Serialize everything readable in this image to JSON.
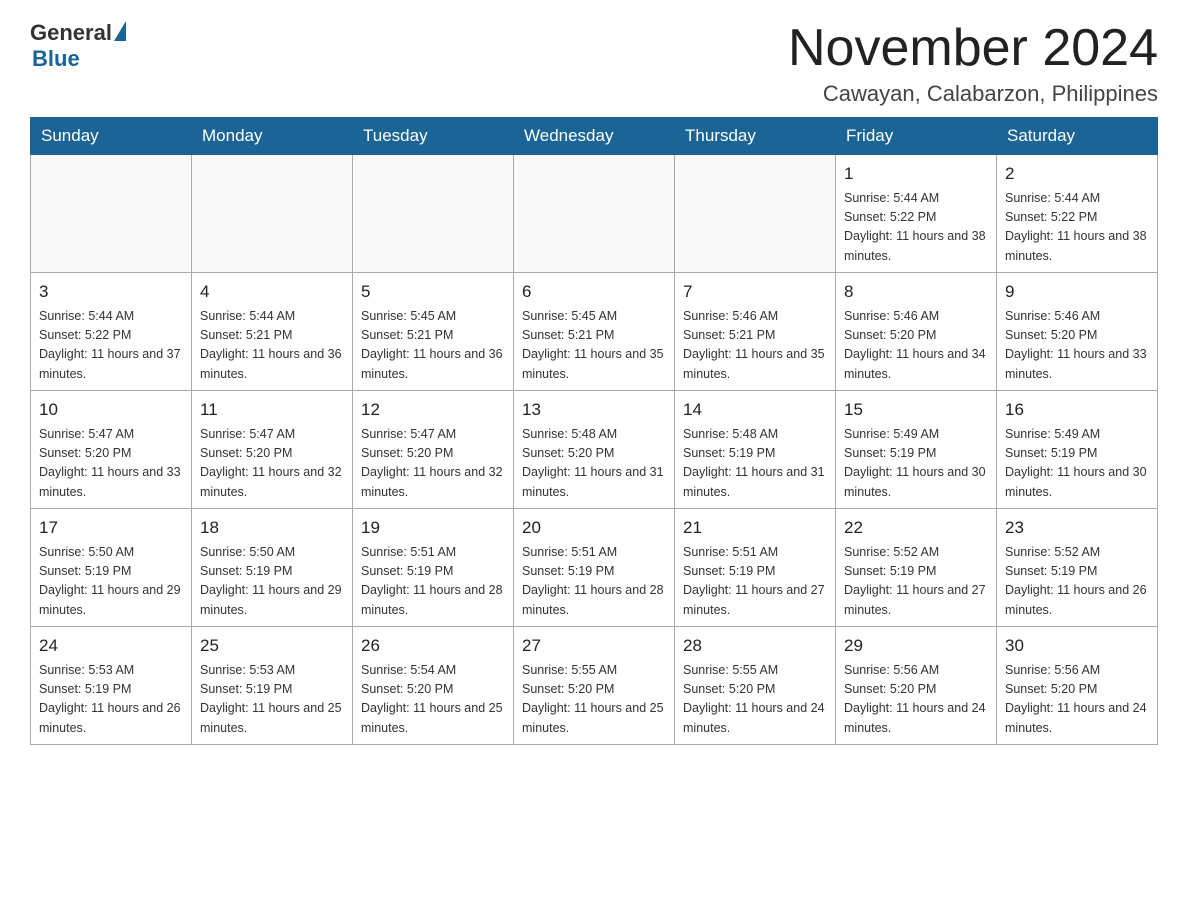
{
  "logo": {
    "general": "General",
    "blue": "Blue"
  },
  "header": {
    "month": "November 2024",
    "location": "Cawayan, Calabarzon, Philippines"
  },
  "weekdays": [
    "Sunday",
    "Monday",
    "Tuesday",
    "Wednesday",
    "Thursday",
    "Friday",
    "Saturday"
  ],
  "weeks": [
    [
      {
        "day": "",
        "sunrise": "",
        "sunset": "",
        "daylight": ""
      },
      {
        "day": "",
        "sunrise": "",
        "sunset": "",
        "daylight": ""
      },
      {
        "day": "",
        "sunrise": "",
        "sunset": "",
        "daylight": ""
      },
      {
        "day": "",
        "sunrise": "",
        "sunset": "",
        "daylight": ""
      },
      {
        "day": "",
        "sunrise": "",
        "sunset": "",
        "daylight": ""
      },
      {
        "day": "1",
        "sunrise": "Sunrise: 5:44 AM",
        "sunset": "Sunset: 5:22 PM",
        "daylight": "Daylight: 11 hours and 38 minutes."
      },
      {
        "day": "2",
        "sunrise": "Sunrise: 5:44 AM",
        "sunset": "Sunset: 5:22 PM",
        "daylight": "Daylight: 11 hours and 38 minutes."
      }
    ],
    [
      {
        "day": "3",
        "sunrise": "Sunrise: 5:44 AM",
        "sunset": "Sunset: 5:22 PM",
        "daylight": "Daylight: 11 hours and 37 minutes."
      },
      {
        "day": "4",
        "sunrise": "Sunrise: 5:44 AM",
        "sunset": "Sunset: 5:21 PM",
        "daylight": "Daylight: 11 hours and 36 minutes."
      },
      {
        "day": "5",
        "sunrise": "Sunrise: 5:45 AM",
        "sunset": "Sunset: 5:21 PM",
        "daylight": "Daylight: 11 hours and 36 minutes."
      },
      {
        "day": "6",
        "sunrise": "Sunrise: 5:45 AM",
        "sunset": "Sunset: 5:21 PM",
        "daylight": "Daylight: 11 hours and 35 minutes."
      },
      {
        "day": "7",
        "sunrise": "Sunrise: 5:46 AM",
        "sunset": "Sunset: 5:21 PM",
        "daylight": "Daylight: 11 hours and 35 minutes."
      },
      {
        "day": "8",
        "sunrise": "Sunrise: 5:46 AM",
        "sunset": "Sunset: 5:20 PM",
        "daylight": "Daylight: 11 hours and 34 minutes."
      },
      {
        "day": "9",
        "sunrise": "Sunrise: 5:46 AM",
        "sunset": "Sunset: 5:20 PM",
        "daylight": "Daylight: 11 hours and 33 minutes."
      }
    ],
    [
      {
        "day": "10",
        "sunrise": "Sunrise: 5:47 AM",
        "sunset": "Sunset: 5:20 PM",
        "daylight": "Daylight: 11 hours and 33 minutes."
      },
      {
        "day": "11",
        "sunrise": "Sunrise: 5:47 AM",
        "sunset": "Sunset: 5:20 PM",
        "daylight": "Daylight: 11 hours and 32 minutes."
      },
      {
        "day": "12",
        "sunrise": "Sunrise: 5:47 AM",
        "sunset": "Sunset: 5:20 PM",
        "daylight": "Daylight: 11 hours and 32 minutes."
      },
      {
        "day": "13",
        "sunrise": "Sunrise: 5:48 AM",
        "sunset": "Sunset: 5:20 PM",
        "daylight": "Daylight: 11 hours and 31 minutes."
      },
      {
        "day": "14",
        "sunrise": "Sunrise: 5:48 AM",
        "sunset": "Sunset: 5:19 PM",
        "daylight": "Daylight: 11 hours and 31 minutes."
      },
      {
        "day": "15",
        "sunrise": "Sunrise: 5:49 AM",
        "sunset": "Sunset: 5:19 PM",
        "daylight": "Daylight: 11 hours and 30 minutes."
      },
      {
        "day": "16",
        "sunrise": "Sunrise: 5:49 AM",
        "sunset": "Sunset: 5:19 PM",
        "daylight": "Daylight: 11 hours and 30 minutes."
      }
    ],
    [
      {
        "day": "17",
        "sunrise": "Sunrise: 5:50 AM",
        "sunset": "Sunset: 5:19 PM",
        "daylight": "Daylight: 11 hours and 29 minutes."
      },
      {
        "day": "18",
        "sunrise": "Sunrise: 5:50 AM",
        "sunset": "Sunset: 5:19 PM",
        "daylight": "Daylight: 11 hours and 29 minutes."
      },
      {
        "day": "19",
        "sunrise": "Sunrise: 5:51 AM",
        "sunset": "Sunset: 5:19 PM",
        "daylight": "Daylight: 11 hours and 28 minutes."
      },
      {
        "day": "20",
        "sunrise": "Sunrise: 5:51 AM",
        "sunset": "Sunset: 5:19 PM",
        "daylight": "Daylight: 11 hours and 28 minutes."
      },
      {
        "day": "21",
        "sunrise": "Sunrise: 5:51 AM",
        "sunset": "Sunset: 5:19 PM",
        "daylight": "Daylight: 11 hours and 27 minutes."
      },
      {
        "day": "22",
        "sunrise": "Sunrise: 5:52 AM",
        "sunset": "Sunset: 5:19 PM",
        "daylight": "Daylight: 11 hours and 27 minutes."
      },
      {
        "day": "23",
        "sunrise": "Sunrise: 5:52 AM",
        "sunset": "Sunset: 5:19 PM",
        "daylight": "Daylight: 11 hours and 26 minutes."
      }
    ],
    [
      {
        "day": "24",
        "sunrise": "Sunrise: 5:53 AM",
        "sunset": "Sunset: 5:19 PM",
        "daylight": "Daylight: 11 hours and 26 minutes."
      },
      {
        "day": "25",
        "sunrise": "Sunrise: 5:53 AM",
        "sunset": "Sunset: 5:19 PM",
        "daylight": "Daylight: 11 hours and 25 minutes."
      },
      {
        "day": "26",
        "sunrise": "Sunrise: 5:54 AM",
        "sunset": "Sunset: 5:20 PM",
        "daylight": "Daylight: 11 hours and 25 minutes."
      },
      {
        "day": "27",
        "sunrise": "Sunrise: 5:55 AM",
        "sunset": "Sunset: 5:20 PM",
        "daylight": "Daylight: 11 hours and 25 minutes."
      },
      {
        "day": "28",
        "sunrise": "Sunrise: 5:55 AM",
        "sunset": "Sunset: 5:20 PM",
        "daylight": "Daylight: 11 hours and 24 minutes."
      },
      {
        "day": "29",
        "sunrise": "Sunrise: 5:56 AM",
        "sunset": "Sunset: 5:20 PM",
        "daylight": "Daylight: 11 hours and 24 minutes."
      },
      {
        "day": "30",
        "sunrise": "Sunrise: 5:56 AM",
        "sunset": "Sunset: 5:20 PM",
        "daylight": "Daylight: 11 hours and 24 minutes."
      }
    ]
  ]
}
